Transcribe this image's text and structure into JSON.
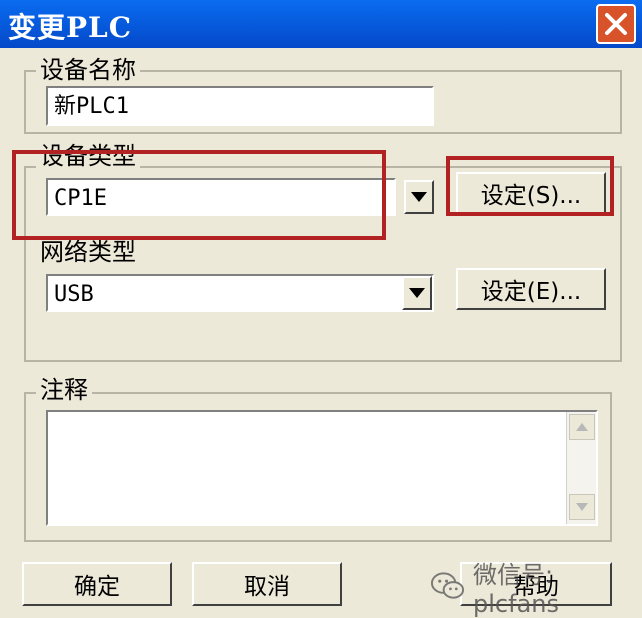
{
  "window": {
    "title": "变更PLC"
  },
  "device_name": {
    "legend": "设备名称",
    "value": "新PLC1"
  },
  "device_type": {
    "legend": "设备类型",
    "value": "CP1E",
    "settings_label": "设定(S)..."
  },
  "network_type": {
    "legend": "网络类型",
    "value": "USB",
    "settings_label": "设定(E)..."
  },
  "comment": {
    "legend": "注释",
    "value": ""
  },
  "footer": {
    "ok_label": "确定",
    "cancel_label": "取消",
    "help_label": "帮助"
  },
  "watermark": {
    "text": "微信号: plcfans"
  },
  "colors": {
    "highlight": "#b32222",
    "title_bar": "#0449c9"
  },
  "icons": {
    "close": "close-icon",
    "dropdown": "chevron-down-icon",
    "scroll_up": "scroll-up-arrow-icon",
    "scroll_down": "scroll-down-arrow-icon",
    "watermark": "wechat-icon"
  }
}
